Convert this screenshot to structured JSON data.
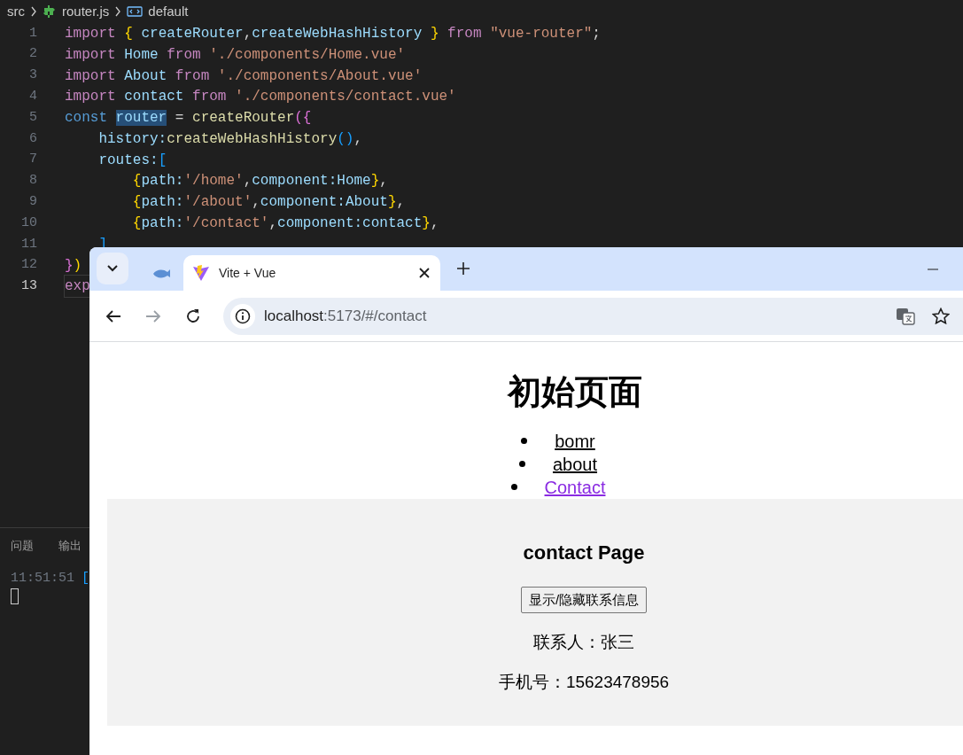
{
  "editor": {
    "breadcrumb": [
      {
        "kind": "folder",
        "label": "src"
      },
      {
        "kind": "file",
        "label": "router.js"
      },
      {
        "kind": "symbol",
        "label": "default"
      }
    ],
    "lines": [
      {
        "number": "1",
        "active": false,
        "tokens": [
          {
            "text": "import ",
            "kind": "kw"
          },
          {
            "text": "{",
            "kind": "b1"
          },
          {
            "text": " createRouter",
            "kind": "var"
          },
          {
            "text": ",",
            "kind": "pl"
          },
          {
            "text": "createWebHashHistory ",
            "kind": "var"
          },
          {
            "text": "}",
            "kind": "b1"
          },
          {
            "text": " from ",
            "kind": "kw"
          },
          {
            "text": "\"vue-router\"",
            "kind": "str"
          },
          {
            "text": ";",
            "kind": "pl"
          }
        ]
      },
      {
        "number": "2",
        "active": false,
        "tokens": [
          {
            "text": "import ",
            "kind": "kw"
          },
          {
            "text": "Home ",
            "kind": "var"
          },
          {
            "text": "from ",
            "kind": "kw"
          },
          {
            "text": "'./components/Home.vue'",
            "kind": "str"
          }
        ]
      },
      {
        "number": "3",
        "active": false,
        "tokens": [
          {
            "text": "import ",
            "kind": "kw"
          },
          {
            "text": "About ",
            "kind": "var"
          },
          {
            "text": "from ",
            "kind": "kw"
          },
          {
            "text": "'./components/About.vue'",
            "kind": "str"
          }
        ]
      },
      {
        "number": "4",
        "active": false,
        "tokens": [
          {
            "text": "import ",
            "kind": "kw"
          },
          {
            "text": "contact ",
            "kind": "var"
          },
          {
            "text": "from ",
            "kind": "kw"
          },
          {
            "text": "'./components/contact.vue'",
            "kind": "str"
          }
        ]
      },
      {
        "number": "5",
        "active": false,
        "tokens": [
          {
            "text": "const ",
            "kind": "decl"
          },
          {
            "text": "router",
            "kind": "var",
            "highlight": true
          },
          {
            "text": " = ",
            "kind": "pl"
          },
          {
            "text": "createRouter",
            "kind": "fn"
          },
          {
            "text": "({",
            "kind": "b2"
          }
        ]
      },
      {
        "number": "6",
        "active": false,
        "tokens": [
          {
            "text": "    history:",
            "kind": "var"
          },
          {
            "text": "createWebHashHistory",
            "kind": "fn"
          },
          {
            "text": "()",
            "kind": "b3"
          },
          {
            "text": ",",
            "kind": "pl"
          }
        ]
      },
      {
        "number": "7",
        "active": false,
        "tokens": [
          {
            "text": "    routes:",
            "kind": "var"
          },
          {
            "text": "[",
            "kind": "b3"
          }
        ]
      },
      {
        "number": "8",
        "active": false,
        "tokens": [
          {
            "text": "        {",
            "kind": "b1"
          },
          {
            "text": "path:",
            "kind": "var"
          },
          {
            "text": "'/home'",
            "kind": "str"
          },
          {
            "text": ",",
            "kind": "pl"
          },
          {
            "text": "component:Home",
            "kind": "var"
          },
          {
            "text": "}",
            "kind": "b1"
          },
          {
            "text": ",",
            "kind": "pl"
          }
        ]
      },
      {
        "number": "9",
        "active": false,
        "tokens": [
          {
            "text": "        {",
            "kind": "b1"
          },
          {
            "text": "path:",
            "kind": "var"
          },
          {
            "text": "'/about'",
            "kind": "str"
          },
          {
            "text": ",",
            "kind": "pl"
          },
          {
            "text": "component:About",
            "kind": "var"
          },
          {
            "text": "}",
            "kind": "b1"
          },
          {
            "text": ",",
            "kind": "pl"
          }
        ]
      },
      {
        "number": "10",
        "active": false,
        "tokens": [
          {
            "text": "        {",
            "kind": "b1"
          },
          {
            "text": "path:",
            "kind": "var"
          },
          {
            "text": "'/contact'",
            "kind": "str"
          },
          {
            "text": ",",
            "kind": "pl"
          },
          {
            "text": "component:contact",
            "kind": "var"
          },
          {
            "text": "}",
            "kind": "b1"
          },
          {
            "text": ",",
            "kind": "pl"
          }
        ]
      },
      {
        "number": "11",
        "active": false,
        "tokens": [
          {
            "text": "    ]",
            "kind": "b3"
          }
        ]
      },
      {
        "number": "12",
        "active": false,
        "tokens": [
          {
            "text": "}",
            "kind": "b2"
          },
          {
            "text": ")",
            "kind": "b1"
          }
        ]
      },
      {
        "number": "13",
        "active": true,
        "tokens": [
          {
            "text": "exp",
            "kind": "kw"
          }
        ]
      }
    ]
  },
  "panel": {
    "tabs": [
      {
        "label": "问题"
      },
      {
        "label": "输出"
      }
    ],
    "log": {
      "time": "11:51:51",
      "text": "["
    }
  },
  "browser": {
    "tabs": [
      {
        "kind": "pinned",
        "selected": false
      },
      {
        "kind": "page",
        "title": "Vite + Vue",
        "selected": true
      }
    ],
    "url": {
      "host": "localhost",
      "rest": ":5173/#/contact"
    },
    "page": {
      "heading": "初始页面",
      "links": [
        {
          "label": "bomr",
          "visited": false
        },
        {
          "label": "about",
          "visited": false
        },
        {
          "label": "Contact",
          "visited": true
        }
      ],
      "section": {
        "title": "contact Page",
        "button": "显示/隐藏联系信息",
        "lines": [
          "联系人：张三",
          "手机号：15623478956"
        ]
      }
    }
  }
}
